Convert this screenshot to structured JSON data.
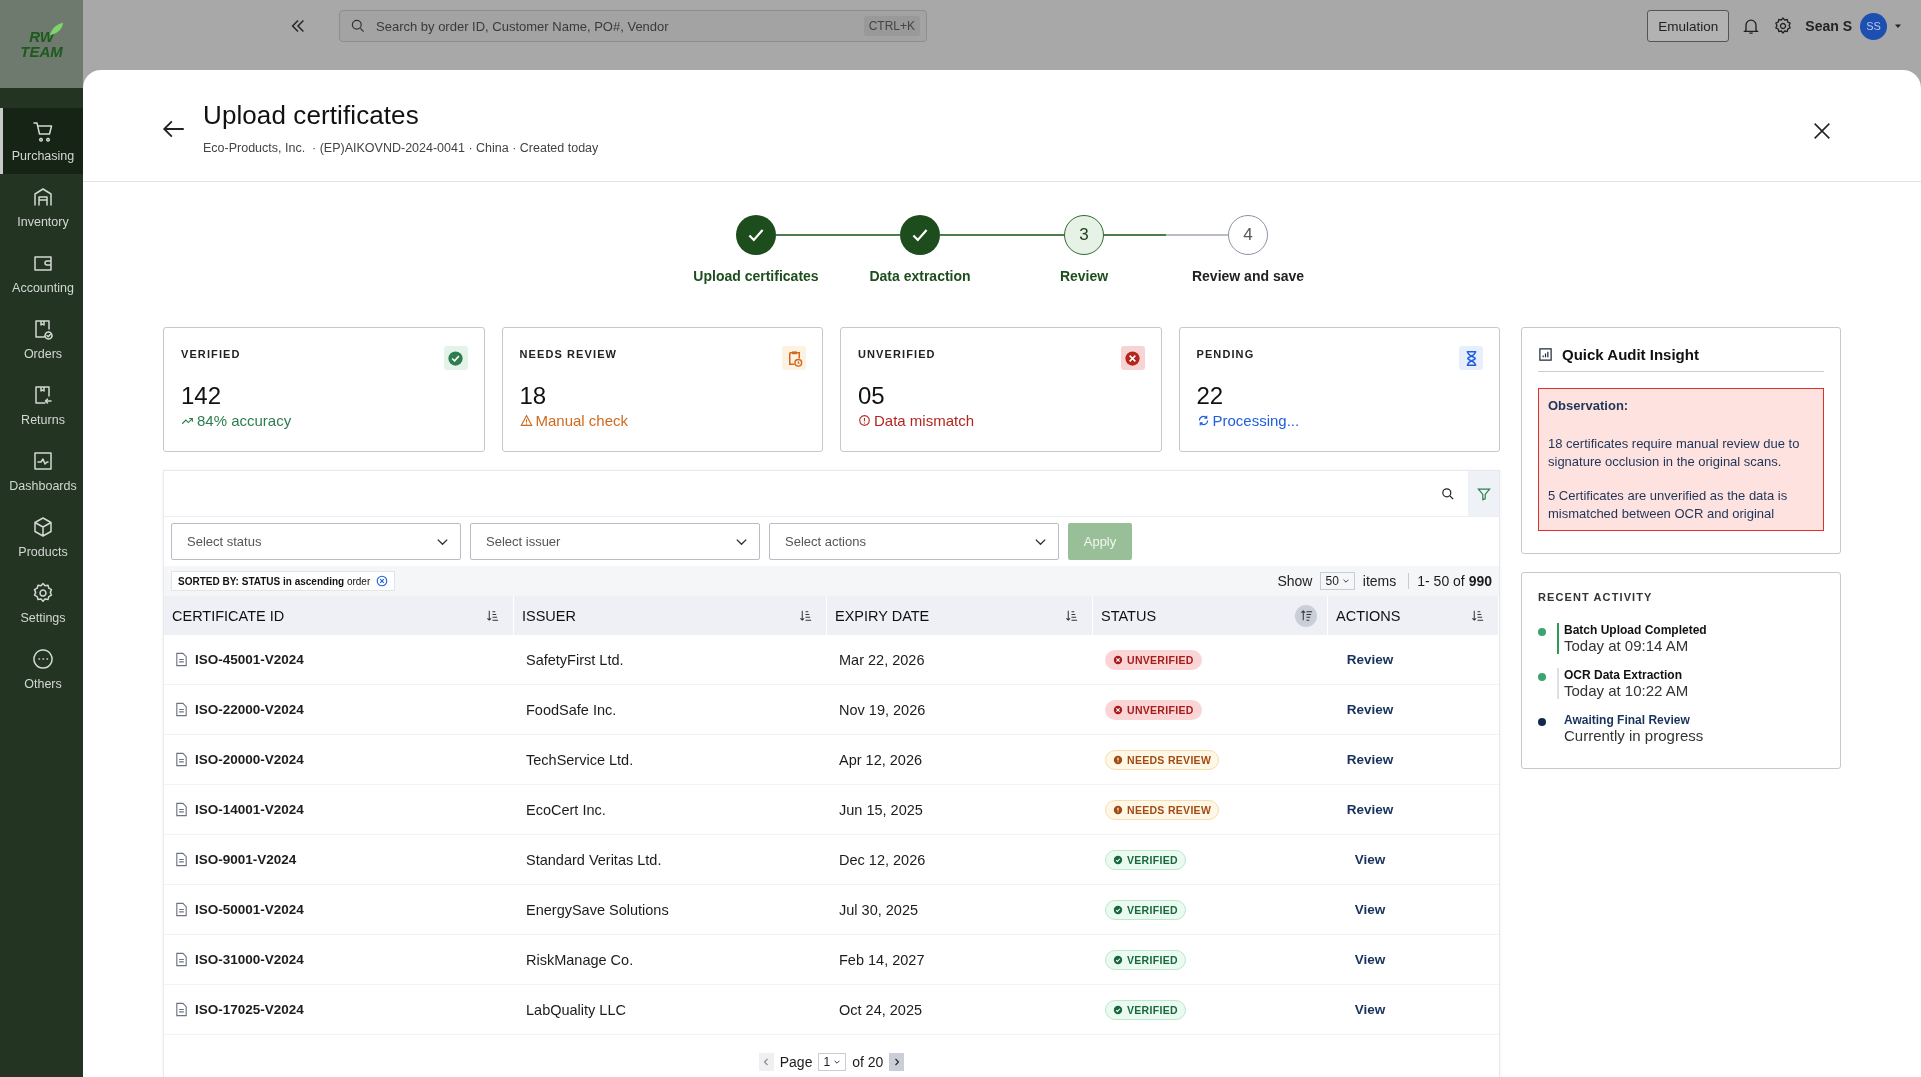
{
  "app": {
    "logo_lines": [
      "RW",
      "TEAM"
    ]
  },
  "sidebar": {
    "items": [
      {
        "label": "Purchasing",
        "selected": true
      },
      {
        "label": "Inventory",
        "selected": false
      },
      {
        "label": "Accounting",
        "selected": false
      },
      {
        "label": "Orders",
        "selected": false
      },
      {
        "label": "Returns",
        "selected": false
      },
      {
        "label": "Dashboards",
        "selected": false
      },
      {
        "label": "Products",
        "selected": false
      },
      {
        "label": "Settings",
        "selected": false
      },
      {
        "label": "Others",
        "selected": false
      }
    ]
  },
  "top_bar": {
    "search": {
      "placeholder": "Search by order ID, Customer Name, PO#, Vendor",
      "shortcut": "CTRL+K"
    },
    "emulation_button": "Emulation",
    "user": {
      "name": "Sean S",
      "initials": "SS"
    }
  },
  "modal": {
    "title": "Upload certificates",
    "subtitle": "Eco-Products, Inc.  · (EP)AIKOVND-2024-0041 · China · Created today"
  },
  "stepper": [
    {
      "label": "Upload certificates",
      "completed": true,
      "current": false
    },
    {
      "label": "Data extraction",
      "completed": true,
      "current": false
    },
    {
      "number": "3",
      "label": "Review",
      "completed": false,
      "current": true
    },
    {
      "number": "4",
      "label": "Review and save",
      "completed": false,
      "current": false
    }
  ],
  "summary_cards": [
    {
      "kind": "verified",
      "title": "VERIFIED",
      "value": "142",
      "note": "84% accuracy"
    },
    {
      "kind": "needs_review",
      "title": "NEEDS REVIEW",
      "value": "18",
      "note": "Manual check"
    },
    {
      "kind": "unverified",
      "title": "UNVERIFIED",
      "value": "05",
      "note": "Data mismatch"
    },
    {
      "kind": "pending",
      "title": "PENDING",
      "value": "22",
      "note": "Processing..."
    }
  ],
  "insight": {
    "title": "Quick Audit Insight",
    "observation_title": "Observation:",
    "paragraphs": [
      "18 certificates require manual review due to signature occlusion in the original scans.",
      "5 Certificates are unverified as the data is mismatched between OCR and original"
    ]
  },
  "recent_activity": {
    "title": "RECENT ACTIVITY",
    "items": [
      {
        "kind": "latest",
        "title": "Batch Upload Completed",
        "time": "Today at 09:14 AM",
        "color": "#3aa56e"
      },
      {
        "kind": "done",
        "title": "OCR Data Extraction",
        "time": "Today at 10:22 AM",
        "color": "#3aa56e"
      },
      {
        "kind": "current",
        "title": "Awaiting Final Review",
        "time": "Currently in progress",
        "color": "#0f2a4a"
      }
    ]
  },
  "table": {
    "filters": [
      {
        "placeholder": "Select status"
      },
      {
        "placeholder": "Select issuer"
      },
      {
        "placeholder": "Select actions"
      }
    ],
    "apply_button": {
      "label": "Apply",
      "disabled": true
    },
    "sort_chip": "**SORTED BY: STATUS in ascending** order",
    "page_size": {
      "before": "Show",
      "value": "50",
      "after": "items"
    },
    "range": "1- 50 of **990**",
    "columns": [
      {
        "label": "CERTIFICATE ID",
        "sorted": false
      },
      {
        "label": "ISSUER",
        "sorted": false
      },
      {
        "label": "EXPIRY DATE",
        "sorted": false
      },
      {
        "label": "STATUS",
        "sorted": true
      },
      {
        "label": "ACTIONS",
        "sorted": false
      }
    ],
    "rows": [
      {
        "id": "ISO-45001-V2024",
        "issuer": "SafetyFirst Ltd.",
        "expiry": "Mar 22, 2026",
        "status": {
          "kind": "unverified",
          "label": "UNVERIFIED"
        },
        "action": "Review"
      },
      {
        "id": "ISO-22000-V2024",
        "issuer": "FoodSafe Inc.",
        "expiry": "Nov 19, 2026",
        "status": {
          "kind": "unverified",
          "label": "UNVERIFIED"
        },
        "action": "Review"
      },
      {
        "id": "ISO-20000-V2024",
        "issuer": "TechService Ltd.",
        "expiry": "Apr 12, 2026",
        "status": {
          "kind": "needs_review",
          "label": "NEEDS REVIEW"
        },
        "action": "Review"
      },
      {
        "id": "ISO-14001-V2024",
        "issuer": "EcoCert Inc.",
        "expiry": "Jun 15, 2025",
        "status": {
          "kind": "needs_review",
          "label": "NEEDS REVIEW"
        },
        "action": "Review"
      },
      {
        "id": "ISO-9001-V2024",
        "issuer": "Standard Veritas Ltd.",
        "expiry": "Dec 12, 2026",
        "status": {
          "kind": "verified",
          "label": "VERIFIED"
        },
        "action": "View"
      },
      {
        "id": "ISO-50001-V2024",
        "issuer": "EnergySave Solutions",
        "expiry": "Jul 30, 2025",
        "status": {
          "kind": "verified",
          "label": "VERIFIED"
        },
        "action": "View"
      },
      {
        "id": "ISO-31000-V2024",
        "issuer": "RiskManage Co.",
        "expiry": "Feb 14, 2027",
        "status": {
          "kind": "verified",
          "label": "VERIFIED"
        },
        "action": "View"
      },
      {
        "id": "ISO-17025-V2024",
        "issuer": "LabQuality LLC",
        "expiry": "Oct 24, 2025",
        "status": {
          "kind": "verified",
          "label": "VERIFIED"
        },
        "action": "View"
      }
    ],
    "pagination": {
      "label": "Page",
      "page": "1",
      "total": "of 20"
    }
  }
}
